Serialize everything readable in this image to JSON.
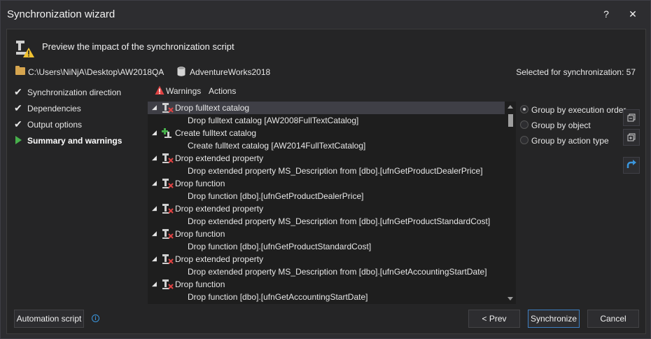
{
  "window": {
    "title": "Synchronization wizard",
    "help_label": "?",
    "close_label": "✕"
  },
  "header": {
    "text": "Preview the impact of the synchronization script"
  },
  "path": {
    "folder": "C:\\Users\\NiNjA\\Desktop\\AW2018QA",
    "separator": "›",
    "database": "AdventureWorks2018",
    "selected": "Selected for synchronization: 57"
  },
  "steps": [
    {
      "label": "Synchronization direction"
    },
    {
      "label": "Dependencies"
    },
    {
      "label": "Output options"
    },
    {
      "label": "Summary and warnings"
    }
  ],
  "toolbar": {
    "warnings": "Warnings",
    "actions": "Actions"
  },
  "list": {
    "rows": [
      {
        "label": "Drop fulltext catalog",
        "type": "drop",
        "expanded": "◢"
      },
      {
        "label": "Drop fulltext catalog [AW2008FullTextCatalog]"
      },
      {
        "label": "Create fulltext catalog",
        "type": "create",
        "expanded": "◢"
      },
      {
        "label": "Create fulltext catalog [AW2014FullTextCatalog]"
      },
      {
        "label": "Drop extended property",
        "type": "drop",
        "expanded": "◢"
      },
      {
        "label": "Drop extended property MS_Description from [dbo].[ufnGetProductDealerPrice]"
      },
      {
        "label": "Drop function",
        "type": "drop",
        "expanded": "◢"
      },
      {
        "label": "Drop function [dbo].[ufnGetProductDealerPrice]"
      },
      {
        "label": "Drop extended property",
        "type": "drop",
        "expanded": "◢"
      },
      {
        "label": "Drop extended property MS_Description from [dbo].[ufnGetProductStandardCost]"
      },
      {
        "label": "Drop function",
        "type": "drop",
        "expanded": "◢"
      },
      {
        "label": "Drop function [dbo].[ufnGetProductStandardCost]"
      },
      {
        "label": "Drop extended property",
        "type": "drop",
        "expanded": "◢"
      },
      {
        "label": "Drop extended property MS_Description from [dbo].[ufnGetAccountingStartDate]"
      },
      {
        "label": "Drop function",
        "type": "drop",
        "expanded": "◢"
      },
      {
        "label": "Drop function [dbo].[ufnGetAccountingStartDate]"
      }
    ]
  },
  "grouping": [
    {
      "label": "Group by execution order"
    },
    {
      "label": "Group by object"
    },
    {
      "label": "Group by action type"
    }
  ],
  "buttons": {
    "automation": "Automation script",
    "info": "i",
    "prev": "< Prev",
    "synchronize": "Synchronize",
    "cancel": "Cancel"
  },
  "colors": {
    "accent": "#3e7fc1",
    "drop_red": "#e04343",
    "create_green": "#47b04b",
    "warning": "#e04343"
  }
}
